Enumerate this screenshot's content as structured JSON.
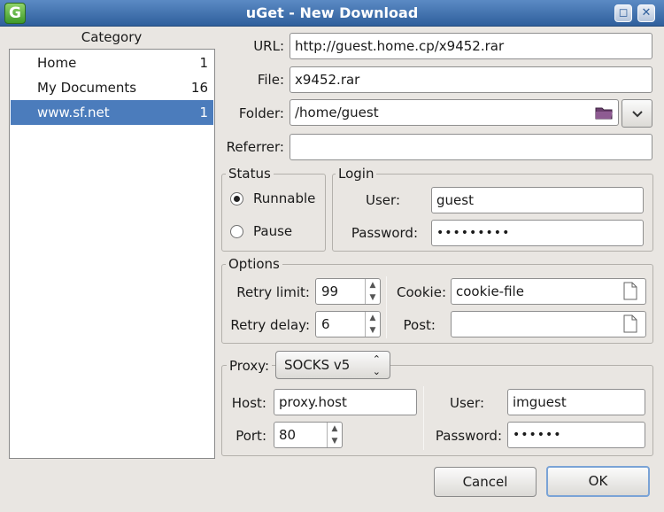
{
  "window": {
    "title": "uGet - New Download",
    "app_icon_letter": "G"
  },
  "category": {
    "title": "Category",
    "items": [
      {
        "label": "Home",
        "count": "1",
        "selected": false
      },
      {
        "label": "My Documents",
        "count": "16",
        "selected": false
      },
      {
        "label": "www.sf.net",
        "count": "1",
        "selected": true
      }
    ]
  },
  "form": {
    "url_label": "URL:",
    "url_value": "http://guest.home.cp/x9452.rar",
    "file_label": "File:",
    "file_value": "x9452.rar",
    "folder_label": "Folder:",
    "folder_value": "/home/guest",
    "referrer_label": "Referrer:",
    "referrer_value": ""
  },
  "status": {
    "title": "Status",
    "options": [
      {
        "label": "Runnable",
        "checked": true
      },
      {
        "label": "Pause",
        "checked": false
      }
    ]
  },
  "login": {
    "title": "Login",
    "user_label": "User:",
    "user_value": "guest",
    "password_label": "Password:",
    "password_value": "•••••••••"
  },
  "options": {
    "title": "Options",
    "retry_limit_label": "Retry limit:",
    "retry_limit_value": "99",
    "retry_delay_label": "Retry delay:",
    "retry_delay_value": "6",
    "cookie_label": "Cookie:",
    "cookie_value": "cookie-file",
    "post_label": "Post:",
    "post_value": ""
  },
  "proxy": {
    "label": "Proxy:",
    "type_value": "SOCKS v5",
    "host_label": "Host:",
    "host_value": "proxy.host",
    "port_label": "Port:",
    "port_value": "80",
    "user_label": "User:",
    "user_value": "imguest",
    "password_label": "Password:",
    "password_value": "••••••"
  },
  "buttons": {
    "cancel": "Cancel",
    "ok": "OK"
  }
}
